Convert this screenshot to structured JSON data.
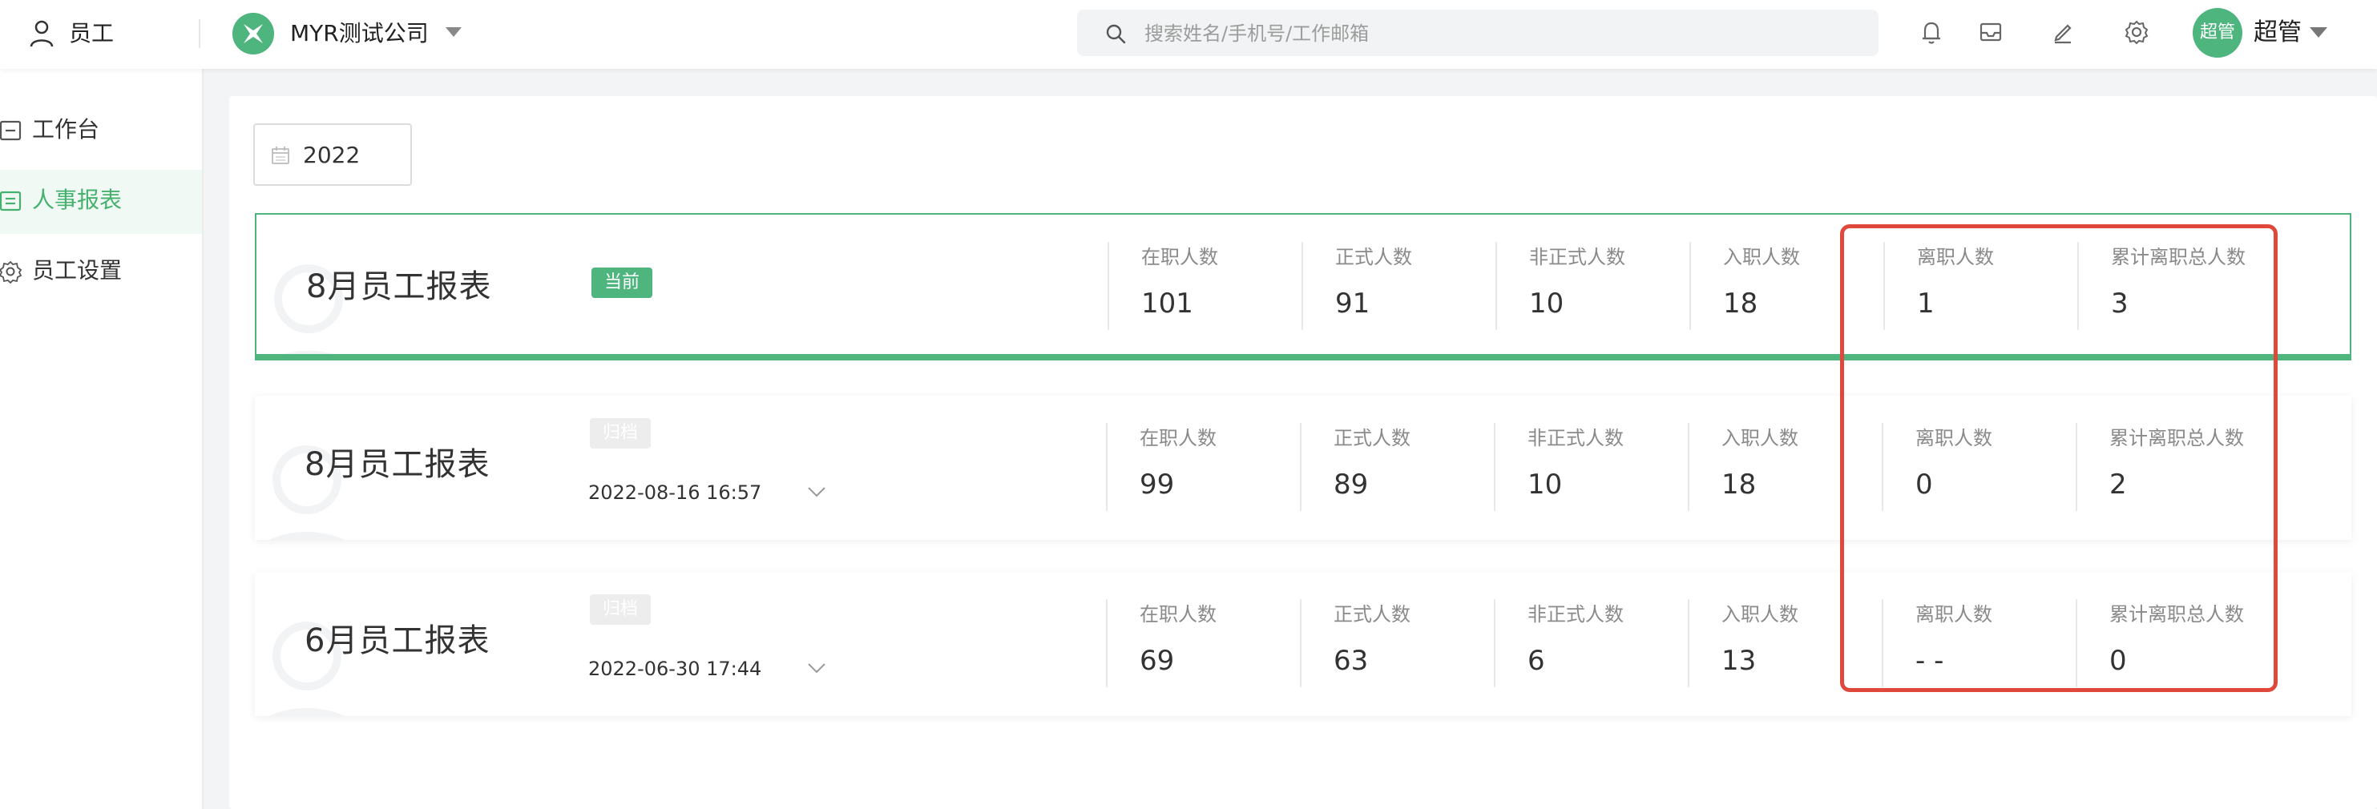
{
  "header": {
    "module_label": "员工",
    "company_name": "MYR测试公司",
    "search_placeholder": "搜索姓名/手机号/工作邮箱",
    "avatar_text": "超管",
    "user_name": "超管",
    "icons": [
      "user-icon",
      "company-logo",
      "search-icon",
      "bell-icon",
      "inbox-icon",
      "edit-icon",
      "gear-icon"
    ]
  },
  "sidebar": {
    "items": [
      {
        "label": "工作台",
        "icon": "workbench-icon"
      },
      {
        "label": "人事报表",
        "icon": "report-icon",
        "active": true
      },
      {
        "label": "员工设置",
        "icon": "gear-icon"
      }
    ]
  },
  "filter": {
    "year": "2022"
  },
  "stat_labels": [
    "在职人数",
    "正式人数",
    "非正式人数",
    "入职人数",
    "离职人数",
    "累计离职总人数"
  ],
  "reports": [
    {
      "title": "8月员工报表",
      "badge": "当前",
      "date": "",
      "values": [
        "101",
        "91",
        "10",
        "18",
        "1",
        "3"
      ]
    },
    {
      "title": "8月员工报表",
      "badge": "归档",
      "date": "2022-08-16 16:57",
      "values": [
        "99",
        "89",
        "10",
        "18",
        "0",
        "2"
      ]
    },
    {
      "title": "6月员工报表",
      "badge": "归档",
      "date": "2022-06-30 17:44",
      "values": [
        "69",
        "63",
        "6",
        "13",
        "- -",
        "0"
      ]
    }
  ],
  "colors": {
    "accent": "#4fb57f",
    "highlight": "#e0483b"
  }
}
